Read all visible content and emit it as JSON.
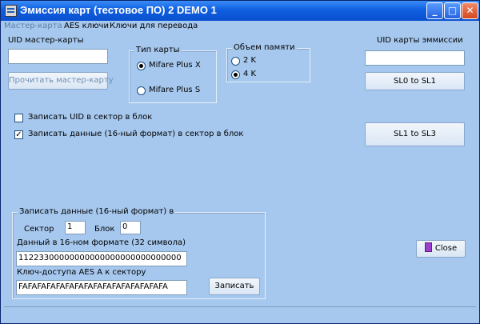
{
  "window": {
    "title": "Эмиссия карт (тестовое ПО) 2  DEMO 1",
    "buttons": {
      "minimize": "_",
      "maximize": "□",
      "close": "✕"
    }
  },
  "menu": {
    "items": [
      "Мастер-карта",
      "AES ключи",
      "Ключи для перевода"
    ]
  },
  "master": {
    "label": "UID мастер-карты",
    "uid_value": "",
    "read_button": "Прочитать мастер-карту"
  },
  "card_type": {
    "title": "Тип карты",
    "options": [
      "Mifare Plus X",
      "Mifare Plus S"
    ],
    "selected": "Mifare Plus X"
  },
  "memory": {
    "title": "Объем памяти",
    "options": [
      "2 K",
      "4 K"
    ],
    "selected": "4 K"
  },
  "emission": {
    "label": "UID карты эммиссии",
    "uid_value": "",
    "sl0_button": "SL0 to SL1",
    "sl1_button": "SL1 to SL3"
  },
  "options": {
    "write_uid": {
      "label": "Записать UID в сектор в блок",
      "checked": false
    },
    "write_data": {
      "label": "Записать данные (16-ный формат) в сектор в блок",
      "checked": true
    }
  },
  "write_group": {
    "title": "Записать данные (16-ный формат) в",
    "sector_label": "Сектор",
    "sector_value": "1",
    "block_label": "Блок",
    "block_value": "0",
    "data_label": "Данный в 16-ном формате (32 символа)",
    "data_value": "11223300000000000000000000000000",
    "key_label": "Ключ-доступа AES А к сектору",
    "key_value": "FAFAFAFAFAFAFAFAFAFAFAFAFAFAFAFA",
    "write_button": "Записать"
  },
  "close_button": "Close",
  "colors": {
    "window_bg": "#a6c8ee",
    "title_blue": "#0a50d0"
  }
}
